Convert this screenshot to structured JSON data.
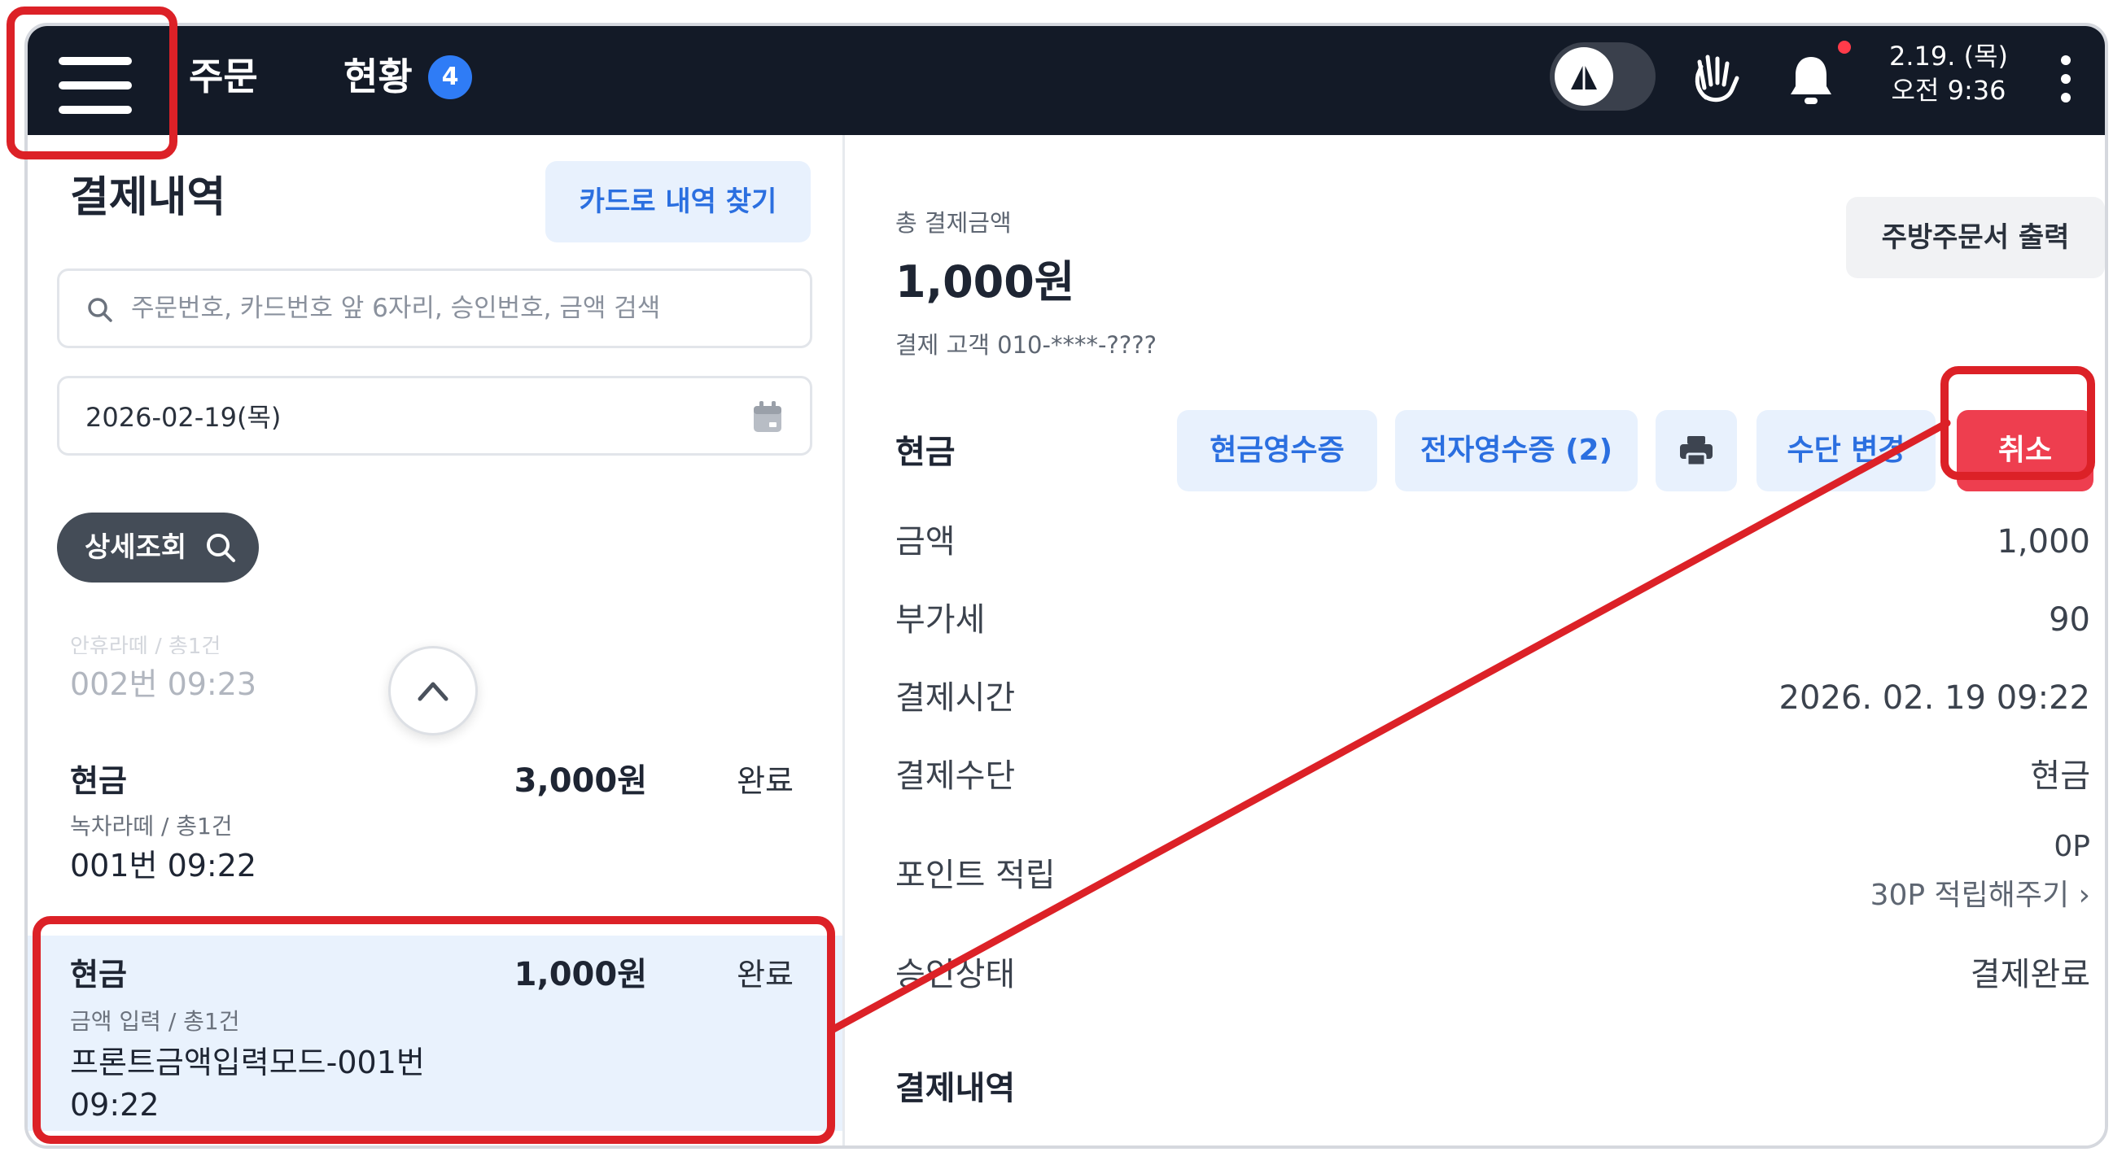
{
  "topbar": {
    "nav_order": "주문",
    "nav_status": "현황",
    "status_badge": "4",
    "clock_date": "2.19. (목)",
    "clock_time": "오전 9:36"
  },
  "left": {
    "title": "결제내역",
    "card_search_label": "카드로 내역 찾기",
    "search_placeholder": "주문번호, 카드번호 앞 6자리, 승인번호, 금액 검색",
    "date_value": "2026-02-19(목)",
    "detail_button": "상세조회",
    "faded_row": {
      "sub": "안휴라떼 / 총1건",
      "order": "002번 09:23"
    },
    "rows": [
      {
        "type": "현금",
        "amount": "3,000원",
        "status": "완료",
        "sub": "녹차라떼 / 총1건",
        "order": "001번 09:22"
      },
      {
        "type": "현금",
        "amount": "1,000원",
        "status": "완료",
        "sub": "금액 입력 / 총1건",
        "order": "프론트금액입력모드-001번 09:22"
      }
    ]
  },
  "right": {
    "total_label": "총 결제금액",
    "total_value": "1,000원",
    "customer": "결제 고객 010-****-????",
    "kitchen_print": "주방주문서 출력",
    "method_title": "현금",
    "btn_cash_receipt": "현금영수증",
    "btn_e_receipt": "전자영수증 (2)",
    "btn_change": "수단 변경",
    "btn_cancel": "취소",
    "info": {
      "amount_label": "금액",
      "amount_value": "1,000",
      "vat_label": "부가세",
      "vat_value": "90",
      "time_label": "결제시간",
      "time_value": "2026. 02. 19 09:22",
      "method_label": "결제수단",
      "method_value": "현금",
      "point_label": "포인트 적립",
      "point_value": "0P",
      "point_link": "30P 적립해주기 ›",
      "approval_label": "승인상태",
      "approval_value": "결제완료"
    },
    "history_title": "결제내역"
  },
  "colors": {
    "topbar_bg": "#131a27",
    "accent_blue": "#2b6fe0",
    "button_bg_blue": "#e8f1fd",
    "cancel_red": "#ee3e4f",
    "annotation_red": "#dc2127",
    "selected_row_bg": "#e9f2fd"
  }
}
